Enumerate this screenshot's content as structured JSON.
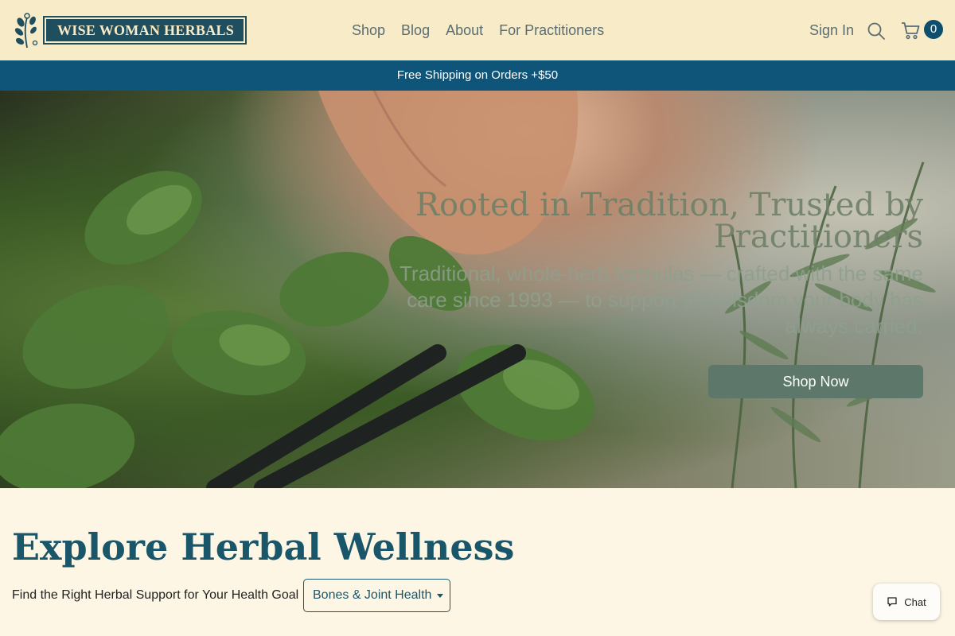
{
  "brand": {
    "name": "WISE WOMAN HERBALS"
  },
  "nav": {
    "items": [
      "Shop",
      "Blog",
      "About",
      "For Practitioners"
    ]
  },
  "header": {
    "sign_in": "Sign In",
    "cart_count": "0",
    "icons": [
      "search-icon",
      "cart-icon"
    ]
  },
  "promo": {
    "text": "Free Shipping on Orders +$50"
  },
  "hero": {
    "title": "Rooted in Tradition, Trusted by Practitioners",
    "subtitle": "Traditional, whole-herb formulas — crafted with the same care since 1993 — to support the wisdom your body has always carried.",
    "cta": "Shop Now"
  },
  "explore": {
    "title": "Explore Herbal Wellness",
    "goal_label": "Find the Right Herbal Support for Your Health Goal",
    "selected_goal": "Bones & Joint Health"
  },
  "chat": {
    "label": "Chat"
  },
  "colors": {
    "header_bg": "#f7ebc8",
    "promo_bg": "#0f557a",
    "brand": "#1f4e5e",
    "cta": "#5d786b",
    "page_bg": "#fdf6e5"
  }
}
